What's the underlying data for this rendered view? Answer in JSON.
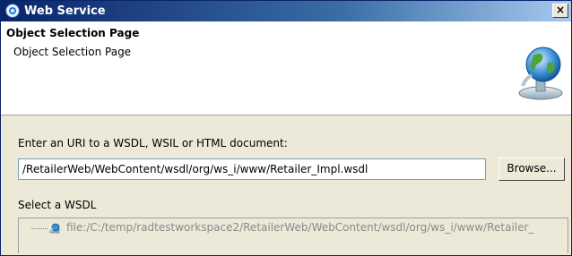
{
  "window": {
    "title": "Web Service",
    "close_label": "×"
  },
  "header": {
    "title": "Object Selection Page",
    "description": "Object Selection Page"
  },
  "uri": {
    "label": "Enter an URI to a WSDL, WSIL or HTML document:",
    "value": "/RetailerWeb/WebContent/wsdl/org/ws_i/www/Retailer_Impl.wsdl",
    "browse_label": "Browse..."
  },
  "wsdl": {
    "label": "Select a WSDL",
    "items": [
      {
        "label": "file:/C:/temp/radtestworkspace2/RetailerWeb/WebContent/wsdl/org/ws_i/www/Retailer_"
      }
    ]
  },
  "colors": {
    "titlebar_start": "#0a246a",
    "titlebar_end": "#a6caf0",
    "dialog_bg": "#ece9d8",
    "disabled_text": "#8a8a8a"
  },
  "icons": {
    "title": "web-service-icon",
    "banner": "globe-icon",
    "tree_item": "wsdl-file-icon"
  }
}
